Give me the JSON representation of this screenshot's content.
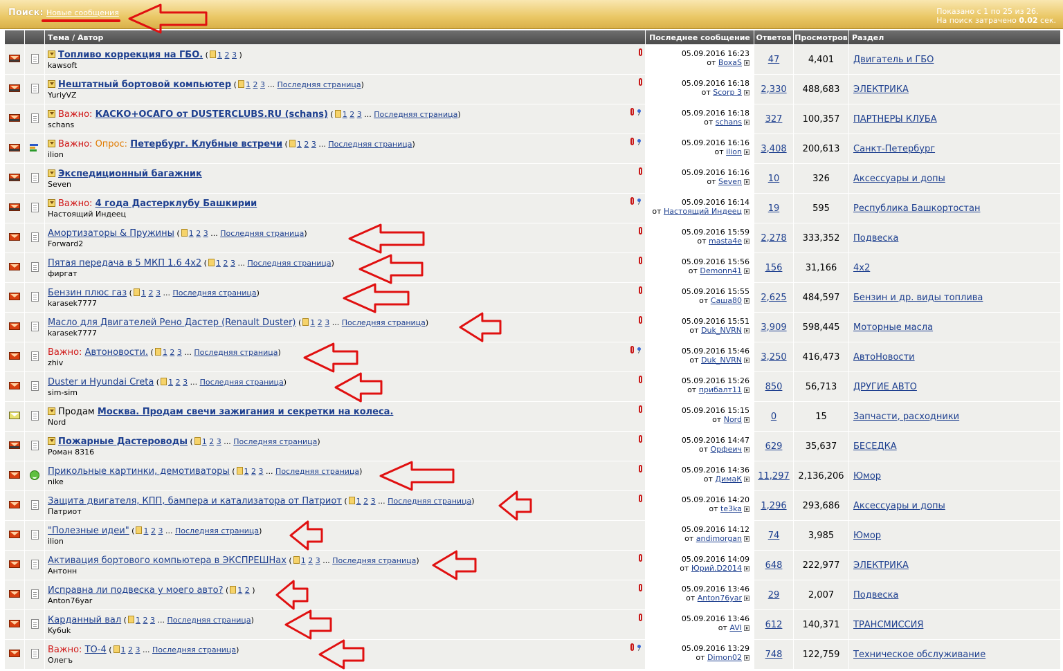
{
  "header": {
    "search_label": "Поиск:",
    "search_link": "Новые сообщения",
    "shown": "Показано с 1 по 25 из 26.",
    "time_prefix": "На поиск затрачено",
    "time_value": "0.02",
    "time_suffix": "сек."
  },
  "columns": {
    "topic": "Тема / Автор",
    "last": "Последнее сообщение",
    "replies": "Ответов",
    "views": "Просмотров",
    "forum": "Раздел"
  },
  "last_page_label": "Последняя страница",
  "from_label": "от",
  "colors": {
    "link": "#1d3f8f",
    "important": "#d01818",
    "poll": "#e07a00",
    "arrow": "#e01010"
  },
  "rows": [
    {
      "status_icon": "envelope-hot-icon",
      "type_icon": "document-icon",
      "subscribed": true,
      "prefix": "",
      "prefix2": "",
      "title": "Топливо коррекция на ГБО.",
      "bold": true,
      "pages": [
        "1",
        "2",
        "3"
      ],
      "last_page": false,
      "author": "kawsoft",
      "attach": true,
      "sticky": false,
      "date": "05.09.2016",
      "time": "16:23",
      "last_user": "BoxaS",
      "replies": "47",
      "views": "4,401",
      "forum": "Двигатель и ГБО"
    },
    {
      "status_icon": "envelope-hot-icon",
      "type_icon": "document-icon",
      "subscribed": true,
      "prefix": "",
      "prefix2": "",
      "title": "Нештатный бортовой компьютер",
      "bold": true,
      "pages": [
        "1",
        "2",
        "3"
      ],
      "last_page": true,
      "author": "YuriyVZ",
      "attach": true,
      "sticky": false,
      "date": "05.09.2016",
      "time": "16:18",
      "last_user": "Scorp 3",
      "replies": "2,330",
      "views": "488,683",
      "forum": "ЭЛЕКТРИКА"
    },
    {
      "status_icon": "envelope-hot-icon",
      "type_icon": "document-icon",
      "subscribed": true,
      "prefix": "Важно:",
      "prefix2": "",
      "title": "КАСКО+ОСАГО от DUSTERCLUBS.RU (schans)",
      "bold": true,
      "pages": [
        "1",
        "2",
        "3"
      ],
      "last_page": true,
      "author": "schans",
      "attach": true,
      "sticky": true,
      "date": "05.09.2016",
      "time": "16:18",
      "last_user": "schans",
      "replies": "327",
      "views": "100,357",
      "forum": "ПАРТНЕРЫ КЛУБА"
    },
    {
      "status_icon": "envelope-hot-icon",
      "type_icon": "poll-icon",
      "subscribed": true,
      "prefix": "Важно:",
      "prefix2": "Опрос:",
      "title": "Петербург. Клубные встречи",
      "bold": true,
      "pages": [
        "1",
        "2",
        "3"
      ],
      "last_page": true,
      "author": "ilion",
      "attach": true,
      "sticky": true,
      "date": "05.09.2016",
      "time": "16:16",
      "last_user": "ilion",
      "replies": "3,408",
      "views": "200,613",
      "forum": "Санкт-Петербург"
    },
    {
      "status_icon": "envelope-hot-icon",
      "type_icon": "document-icon",
      "subscribed": true,
      "prefix": "",
      "prefix2": "",
      "title": "Экспедиционный багажник",
      "bold": true,
      "pages": [],
      "last_page": false,
      "author": "Seven",
      "attach": true,
      "sticky": false,
      "date": "05.09.2016",
      "time": "16:16",
      "last_user": "Seven",
      "replies": "10",
      "views": "326",
      "forum": "Аксессуары и допы"
    },
    {
      "status_icon": "envelope-hot-icon",
      "type_icon": "document-icon",
      "subscribed": true,
      "prefix": "Важно:",
      "prefix2": "",
      "title": "4 года Дастерклубу Башкирии",
      "bold": true,
      "pages": [],
      "last_page": false,
      "author": "Настоящий Индеец",
      "attach": true,
      "sticky": true,
      "date": "05.09.2016",
      "time": "16:14",
      "last_user": "Настоящий Индеец",
      "replies": "19",
      "views": "595",
      "forum": "Республика Башкортостан"
    },
    {
      "status_icon": "envelope-icon",
      "type_icon": "document-icon",
      "subscribed": false,
      "prefix": "",
      "prefix2": "",
      "title": "Амортизаторы & Пружины",
      "bold": false,
      "pages": [
        "1",
        "2",
        "3"
      ],
      "last_page": true,
      "author": "Forward2",
      "attach": true,
      "sticky": false,
      "date": "05.09.2016",
      "time": "15:59",
      "last_user": "masta4e",
      "replies": "2,278",
      "views": "333,352",
      "forum": "Подвеска"
    },
    {
      "status_icon": "envelope-icon",
      "type_icon": "document-icon",
      "subscribed": false,
      "prefix": "",
      "prefix2": "",
      "title": "Пятая передача в 5 МКП 1.6 4x2",
      "bold": false,
      "pages": [
        "1",
        "2",
        "3"
      ],
      "last_page": true,
      "author": "фиргат",
      "attach": true,
      "sticky": false,
      "date": "05.09.2016",
      "time": "15:56",
      "last_user": "Demonn41",
      "replies": "156",
      "views": "31,166",
      "forum": "4x2"
    },
    {
      "status_icon": "envelope-icon",
      "type_icon": "document-icon",
      "subscribed": false,
      "prefix": "",
      "prefix2": "",
      "title": "Бензин плюс газ",
      "bold": false,
      "pages": [
        "1",
        "2",
        "3"
      ],
      "last_page": true,
      "author": "karasek7777",
      "attach": true,
      "sticky": false,
      "date": "05.09.2016",
      "time": "15:55",
      "last_user": "Саша80",
      "replies": "2,625",
      "views": "484,597",
      "forum": "Бензин и др. виды топлива"
    },
    {
      "status_icon": "envelope-icon",
      "type_icon": "document-icon",
      "subscribed": false,
      "prefix": "",
      "prefix2": "",
      "title": "Масло для Двигателей Рено Дастер (Renault Duster)",
      "bold": false,
      "pages": [
        "1",
        "2",
        "3"
      ],
      "last_page": true,
      "author": "karasek7777",
      "attach": true,
      "sticky": false,
      "date": "05.09.2016",
      "time": "15:51",
      "last_user": "Duk_NVRN",
      "replies": "3,909",
      "views": "598,445",
      "forum": "Моторные масла"
    },
    {
      "status_icon": "envelope-icon",
      "type_icon": "document-icon",
      "subscribed": false,
      "prefix": "Важно:",
      "prefix2": "",
      "title": "Автоновости.",
      "bold": false,
      "pages": [
        "1",
        "2",
        "3"
      ],
      "last_page": true,
      "author": "zhiv",
      "attach": true,
      "sticky": true,
      "date": "05.09.2016",
      "time": "15:46",
      "last_user": "Duk_NVRN",
      "replies": "3,250",
      "views": "416,473",
      "forum": "АвтоНовости"
    },
    {
      "status_icon": "envelope-icon",
      "type_icon": "document-icon",
      "subscribed": false,
      "prefix": "",
      "prefix2": "",
      "title": "Duster и Hyundai Creta",
      "bold": false,
      "pages": [
        "1",
        "2",
        "3"
      ],
      "last_page": true,
      "author": "sim-sim",
      "attach": true,
      "sticky": false,
      "date": "05.09.2016",
      "time": "15:26",
      "last_user": "прибалт11",
      "replies": "850",
      "views": "56,713",
      "forum": "ДРУГИЕ АВТО"
    },
    {
      "status_icon": "envelope-read-icon",
      "type_icon": "document-icon",
      "subscribed": true,
      "prefix": "",
      "prefix2": "Продам",
      "title": "Москва. Продам свечи зажигания и секретки на колеса.",
      "bold": true,
      "pages": [],
      "last_page": false,
      "author": "Nord",
      "attach": true,
      "sticky": false,
      "date": "05.09.2016",
      "time": "15:15",
      "last_user": "Nord",
      "replies": "0",
      "views": "15",
      "forum": "Запчасти, расходники"
    },
    {
      "status_icon": "envelope-hot-icon",
      "type_icon": "document-icon",
      "subscribed": true,
      "prefix": "",
      "prefix2": "",
      "title": "Пожарные Дастероводы",
      "bold": true,
      "pages": [
        "1",
        "2",
        "3"
      ],
      "last_page": true,
      "author": "Роман 8316",
      "attach": true,
      "sticky": false,
      "date": "05.09.2016",
      "time": "14:47",
      "last_user": "Орфеич",
      "replies": "629",
      "views": "35,637",
      "forum": "БЕСЕДКА"
    },
    {
      "status_icon": "envelope-icon",
      "type_icon": "smile-icon",
      "subscribed": false,
      "prefix": "",
      "prefix2": "",
      "title": "Прикольные картинки, демотиваторы",
      "bold": false,
      "pages": [
        "1",
        "2",
        "3"
      ],
      "last_page": true,
      "author": "nike",
      "attach": true,
      "sticky": false,
      "date": "05.09.2016",
      "time": "14:36",
      "last_user": "ДимаК",
      "replies": "11,297",
      "views": "2,136,206",
      "forum": "Юмор"
    },
    {
      "status_icon": "envelope-icon",
      "type_icon": "document-icon",
      "subscribed": false,
      "prefix": "",
      "prefix2": "",
      "title": "Защита двигателя, КПП, бампера и катализатора от Патриот",
      "bold": false,
      "pages": [
        "1",
        "2",
        "3"
      ],
      "last_page": true,
      "author": "Патриот",
      "attach": true,
      "sticky": false,
      "date": "05.09.2016",
      "time": "14:20",
      "last_user": "te3ka",
      "replies": "1,296",
      "views": "293,686",
      "forum": "Аксессуары и допы"
    },
    {
      "status_icon": "envelope-icon",
      "type_icon": "document-icon",
      "subscribed": false,
      "prefix": "",
      "prefix2": "",
      "title": "\"Полезные идеи\"",
      "bold": false,
      "pages": [
        "1",
        "2",
        "3"
      ],
      "last_page": true,
      "author": "ilion",
      "attach": false,
      "sticky": false,
      "date": "05.09.2016",
      "time": "14:12",
      "last_user": "andimorgan",
      "replies": "74",
      "views": "3,985",
      "forum": "Юмор"
    },
    {
      "status_icon": "envelope-icon",
      "type_icon": "document-icon",
      "subscribed": false,
      "prefix": "",
      "prefix2": "",
      "title": "Активация бортового компьютера в ЭКСПРЕШНах",
      "bold": false,
      "pages": [
        "1",
        "2",
        "3"
      ],
      "last_page": true,
      "author": "Антонн",
      "attach": true,
      "sticky": false,
      "date": "05.09.2016",
      "time": "14:09",
      "last_user": "Юрий.D2014",
      "replies": "648",
      "views": "222,977",
      "forum": "ЭЛЕКТРИКА"
    },
    {
      "status_icon": "envelope-icon",
      "type_icon": "document-icon",
      "subscribed": false,
      "prefix": "",
      "prefix2": "",
      "title": "Исправна ли подвеска у моего авто?",
      "bold": false,
      "pages": [
        "1",
        "2"
      ],
      "last_page": false,
      "author": "Anton76yar",
      "attach": true,
      "sticky": false,
      "date": "05.09.2016",
      "time": "13:46",
      "last_user": "Anton76yar",
      "replies": "29",
      "views": "2,007",
      "forum": "Подвеска"
    },
    {
      "status_icon": "envelope-icon",
      "type_icon": "document-icon",
      "subscribed": false,
      "prefix": "",
      "prefix2": "",
      "title": "Карданный вал",
      "bold": false,
      "pages": [
        "1",
        "2",
        "3"
      ],
      "last_page": true,
      "author": "Ky6uk",
      "attach": true,
      "sticky": false,
      "date": "05.09.2016",
      "time": "13:46",
      "last_user": "AVI",
      "replies": "612",
      "views": "140,371",
      "forum": "ТРАНСМИССИЯ"
    },
    {
      "status_icon": "envelope-icon",
      "type_icon": "document-icon",
      "subscribed": false,
      "prefix": "Важно:",
      "prefix2": "",
      "title": "ТО-4",
      "bold": false,
      "pages": [
        "1",
        "2",
        "3"
      ],
      "last_page": true,
      "author": "Олегъ",
      "attach": true,
      "sticky": true,
      "date": "05.09.2016",
      "time": "13:29",
      "last_user": "Dimon02",
      "replies": "748",
      "views": "122,759",
      "forum": "Техническое обслуживание"
    }
  ]
}
